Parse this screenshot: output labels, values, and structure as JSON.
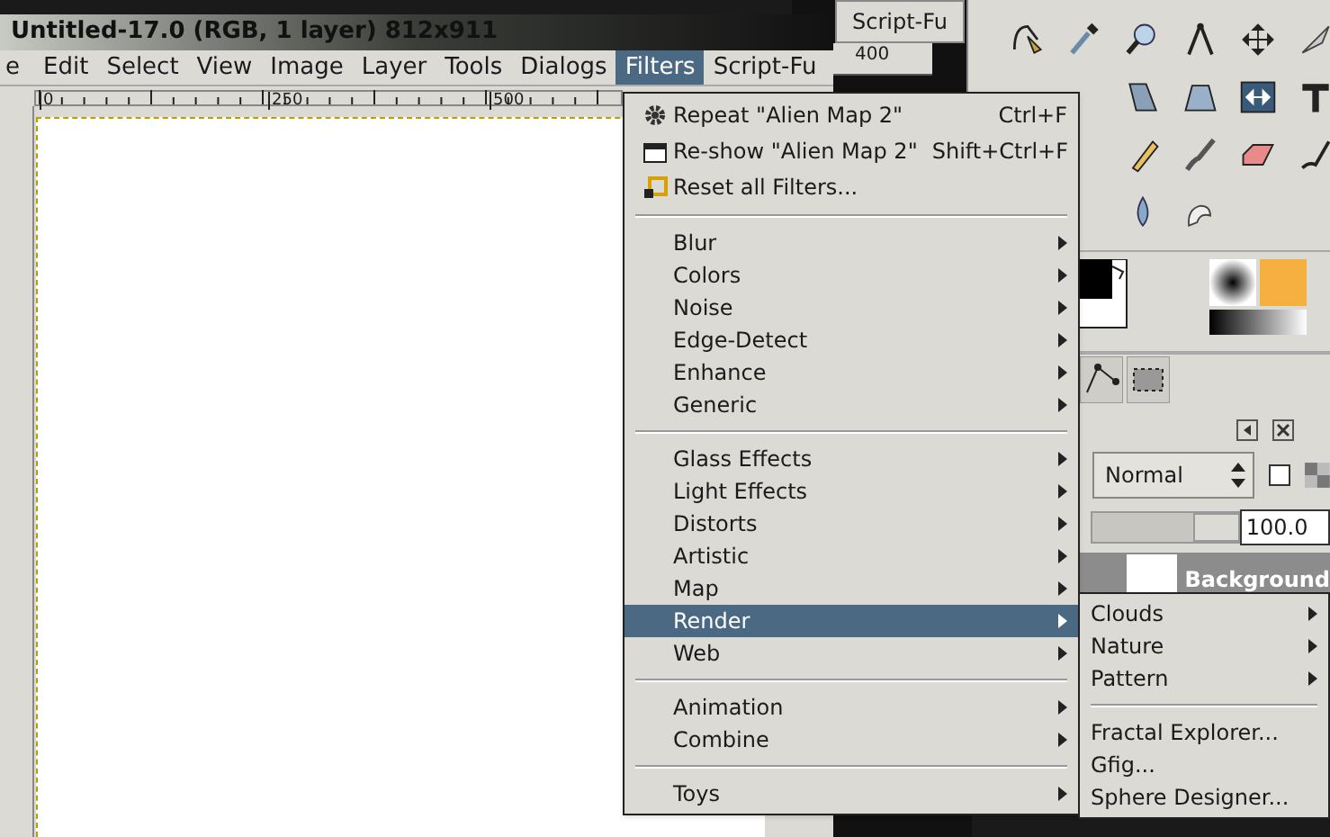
{
  "image_window": {
    "title": "Untitled-17.0 (RGB, 1 layer) 812x911",
    "menubar": [
      {
        "label": "e",
        "selected": false
      },
      {
        "label": "Edit",
        "selected": false
      },
      {
        "label": "Select",
        "selected": false
      },
      {
        "label": "View",
        "selected": false
      },
      {
        "label": "Image",
        "selected": false
      },
      {
        "label": "Layer",
        "selected": false
      },
      {
        "label": "Tools",
        "selected": false
      },
      {
        "label": "Dialogs",
        "selected": false
      },
      {
        "label": "Filters",
        "selected": true
      },
      {
        "label": "Script-Fu",
        "selected": false
      }
    ],
    "ruler": [
      "0",
      "250",
      "500"
    ]
  },
  "back_window": {
    "tab": "Script-Fu",
    "ruler": "400"
  },
  "layers": {
    "mode": "Normal",
    "lock_checked": false,
    "opacity": "100.0",
    "level": 1,
    "layer_name": "Background"
  },
  "filters_menu": [
    {
      "kind": "action",
      "label": "Repeat \"Alien Map 2\"",
      "shortcut": "Ctrl+F",
      "selected": false
    },
    {
      "kind": "action",
      "label": "Re-show \"Alien Map 2\"",
      "shortcut": "Shift+Ctrl+F",
      "selected": false
    },
    {
      "kind": "action",
      "label": "Reset all Filters...",
      "selected": false
    },
    {
      "kind": "separator"
    },
    {
      "kind": "submenu",
      "label": "Blur",
      "selected": false
    },
    {
      "kind": "submenu",
      "label": "Colors",
      "selected": false
    },
    {
      "kind": "submenu",
      "label": "Noise",
      "selected": false
    },
    {
      "kind": "submenu",
      "label": "Edge-Detect",
      "selected": false
    },
    {
      "kind": "submenu",
      "label": "Enhance",
      "selected": false
    },
    {
      "kind": "submenu",
      "label": "Generic",
      "selected": false
    },
    {
      "kind": "separator"
    },
    {
      "kind": "submenu",
      "label": "Glass Effects",
      "selected": false
    },
    {
      "kind": "submenu",
      "label": "Light Effects",
      "selected": false
    },
    {
      "kind": "submenu",
      "label": "Distorts",
      "selected": false
    },
    {
      "kind": "submenu",
      "label": "Artistic",
      "selected": false
    },
    {
      "kind": "submenu",
      "label": "Map",
      "selected": false
    },
    {
      "kind": "submenu",
      "label": "Render",
      "selected": true
    },
    {
      "kind": "submenu",
      "label": "Web",
      "selected": false
    },
    {
      "kind": "separator"
    },
    {
      "kind": "submenu",
      "label": "Animation",
      "selected": false
    },
    {
      "kind": "submenu",
      "label": "Combine",
      "selected": false
    },
    {
      "kind": "separator"
    },
    {
      "kind": "submenu",
      "label": "Toys",
      "selected": false
    }
  ],
  "render_submenu": [
    {
      "kind": "submenu",
      "label": "Clouds",
      "selected": false
    },
    {
      "kind": "submenu",
      "label": "Nature",
      "selected": false
    },
    {
      "kind": "submenu",
      "label": "Pattern",
      "selected": false
    },
    {
      "kind": "separator"
    },
    {
      "kind": "action",
      "label": "Fractal Explorer...",
      "selected": false
    },
    {
      "kind": "action",
      "label": "Gfig...",
      "selected": false
    },
    {
      "kind": "action",
      "label": "Sphere Designer...",
      "selected": false
    }
  ]
}
